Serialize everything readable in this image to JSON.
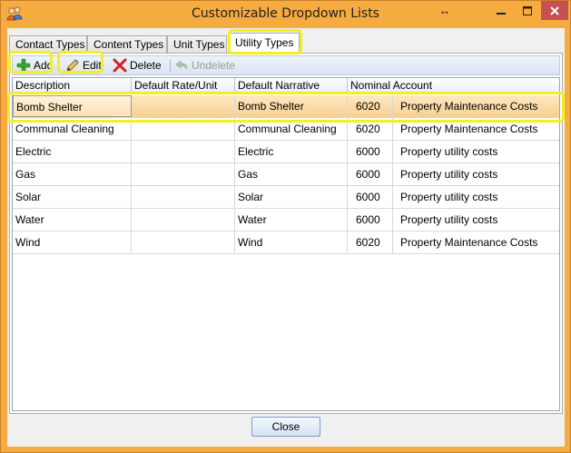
{
  "window": {
    "title": "Customizable Dropdown Lists",
    "resize_glyph": "↔"
  },
  "tabs": [
    {
      "label": "Contact Types"
    },
    {
      "label": "Content Types"
    },
    {
      "label": "Unit Types"
    },
    {
      "label": "Utility Types",
      "active": true
    }
  ],
  "toolbar": {
    "add_label": "Add",
    "edit_label": "Edit",
    "delete_label": "Delete",
    "undelete_label": "Undelete"
  },
  "grid": {
    "columns": [
      "Description",
      "Default Rate/Unit",
      "Default Narrative",
      "Nominal Account"
    ],
    "rows": [
      {
        "description": "Bomb Shelter",
        "rate": "",
        "narrative": "Bomb Shelter",
        "account_code": "6020",
        "account_name": "Property Maintenance Costs",
        "selected": true
      },
      {
        "description": "Communal Cleaning",
        "rate": "",
        "narrative": "Communal Cleaning",
        "account_code": "6020",
        "account_name": "Property Maintenance Costs"
      },
      {
        "description": "Electric",
        "rate": "",
        "narrative": "Electric",
        "account_code": "6000",
        "account_name": "Property utility costs"
      },
      {
        "description": "Gas",
        "rate": "",
        "narrative": "Gas",
        "account_code": "6000",
        "account_name": "Property utility costs"
      },
      {
        "description": "Solar",
        "rate": "",
        "narrative": "Solar",
        "account_code": "6000",
        "account_name": "Property utility costs"
      },
      {
        "description": "Water",
        "rate": "",
        "narrative": "Water",
        "account_code": "6000",
        "account_name": "Property utility costs"
      },
      {
        "description": "Wind",
        "rate": "",
        "narrative": "Wind",
        "account_code": "6020",
        "account_name": "Property Maintenance Costs"
      }
    ]
  },
  "footer": {
    "close_label": "Close"
  },
  "colors": {
    "window_frame": "#f5ab3f",
    "highlight": "#f2ef24",
    "selected_row": "#f8cf8e",
    "close_button": "#c75050"
  },
  "icons": {
    "app": "people-icon",
    "add": "green-plus-icon",
    "edit": "pencil-icon",
    "delete": "red-x-icon",
    "undelete": "undo-arrow-icon"
  }
}
